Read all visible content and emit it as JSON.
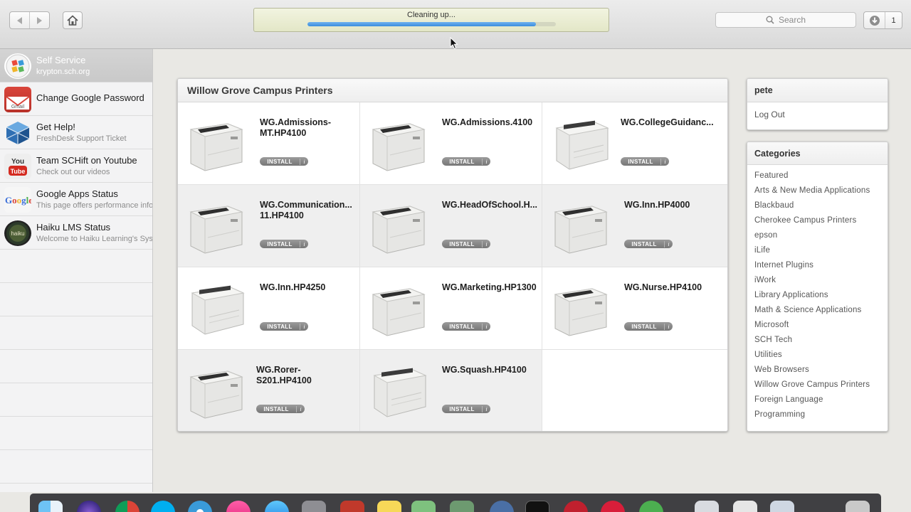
{
  "toolbar": {
    "status_text": "Cleaning up...",
    "progress_percent": 92,
    "search_placeholder": "Search",
    "downloads_count": "1"
  },
  "sidebar": {
    "items": [
      {
        "title": "Self Service",
        "subtitle": "krypton.sch.org",
        "icon": "self-service-icon",
        "selected": true
      },
      {
        "title": "Change Google Password",
        "subtitle": "",
        "icon": "gmail-icon",
        "selected": false
      },
      {
        "title": "Get Help!",
        "subtitle": "FreshDesk Support Ticket",
        "icon": "help-cube-icon",
        "selected": false
      },
      {
        "title": "Team SCHift on Youtube",
        "subtitle": "Check out our videos",
        "icon": "youtube-icon",
        "selected": false
      },
      {
        "title": "Google Apps Status",
        "subtitle": "This page offers performance info",
        "icon": "google-icon",
        "selected": false
      },
      {
        "title": "Haiku LMS Status",
        "subtitle": "Welcome to Haiku Learning's Syst",
        "icon": "haiku-icon",
        "selected": false
      }
    ]
  },
  "main": {
    "title": "Willow Grove Campus Printers",
    "install_label": "INSTALL",
    "info_label": "i",
    "items": [
      {
        "name": "WG.Admissions-MT.HP4100",
        "icon": "printer-icon"
      },
      {
        "name": "WG.Admissions.4100",
        "icon": "printer-icon"
      },
      {
        "name": "WG.CollegeGuidanc...",
        "icon": "printer-icon"
      },
      {
        "name": "WG.Communication... 11.HP4100",
        "icon": "printer-icon"
      },
      {
        "name": "WG.HeadOfSchool.H...",
        "icon": "printer-icon"
      },
      {
        "name": "WG.Inn.HP4000",
        "icon": "printer-icon"
      },
      {
        "name": "WG.Inn.HP4250",
        "icon": "printer-icon"
      },
      {
        "name": "WG.Marketing.HP1300",
        "icon": "printer-icon"
      },
      {
        "name": "WG.Nurse.HP4100",
        "icon": "printer-icon"
      },
      {
        "name": "WG.Rorer-S201.HP4100",
        "icon": "printer-icon"
      },
      {
        "name": "WG.Squash.HP4100",
        "icon": "printer-icon"
      }
    ]
  },
  "user": {
    "name": "pete",
    "logout_label": "Log Out"
  },
  "categories": {
    "title": "Categories",
    "items": [
      "Featured",
      "Arts & New Media Applications",
      "Blackbaud",
      "Cherokee Campus Printers",
      "epson",
      "iLife",
      "Internet Plugins",
      "iWork",
      "Library Applications",
      "Math & Science Applications",
      "Microsoft",
      "SCH Tech",
      "Utilities",
      "Web Browsers",
      "Willow Grove Campus Printers",
      "Foreign Language",
      "Programming"
    ]
  },
  "colors": {
    "accent_blue": "#3b8ede",
    "status_bg": "#e3e7c7",
    "install_button": "#888888"
  }
}
